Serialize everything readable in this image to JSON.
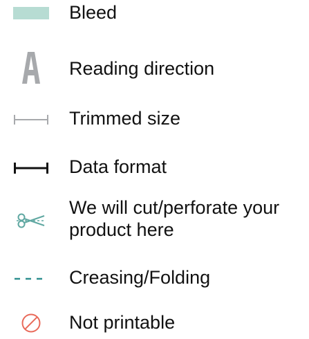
{
  "legend": {
    "items": [
      {
        "id": "bleed",
        "icon": "bleed-swatch-icon",
        "label": "Bleed",
        "color": "#b7dcd3"
      },
      {
        "id": "reading-direction",
        "icon": "letter-a-icon",
        "label": "Reading direction",
        "color": "#a7a9ac"
      },
      {
        "id": "trimmed-size",
        "icon": "trim-line-icon",
        "label": "Trimmed size",
        "color": "#a7a9ac"
      },
      {
        "id": "data-format",
        "icon": "data-format-line-icon",
        "label": "Data format",
        "color": "#111111"
      },
      {
        "id": "cut-perforate",
        "icon": "scissors-icon",
        "label": "We will cut/perforate your product here",
        "color": "#5fa7a1"
      },
      {
        "id": "creasing-folding",
        "icon": "dashed-line-icon",
        "label": "Creasing/Folding",
        "color": "#2e8f8f"
      },
      {
        "id": "not-printable",
        "icon": "prohibited-icon",
        "label": "Not printable",
        "color": "#e96a5a"
      }
    ]
  }
}
